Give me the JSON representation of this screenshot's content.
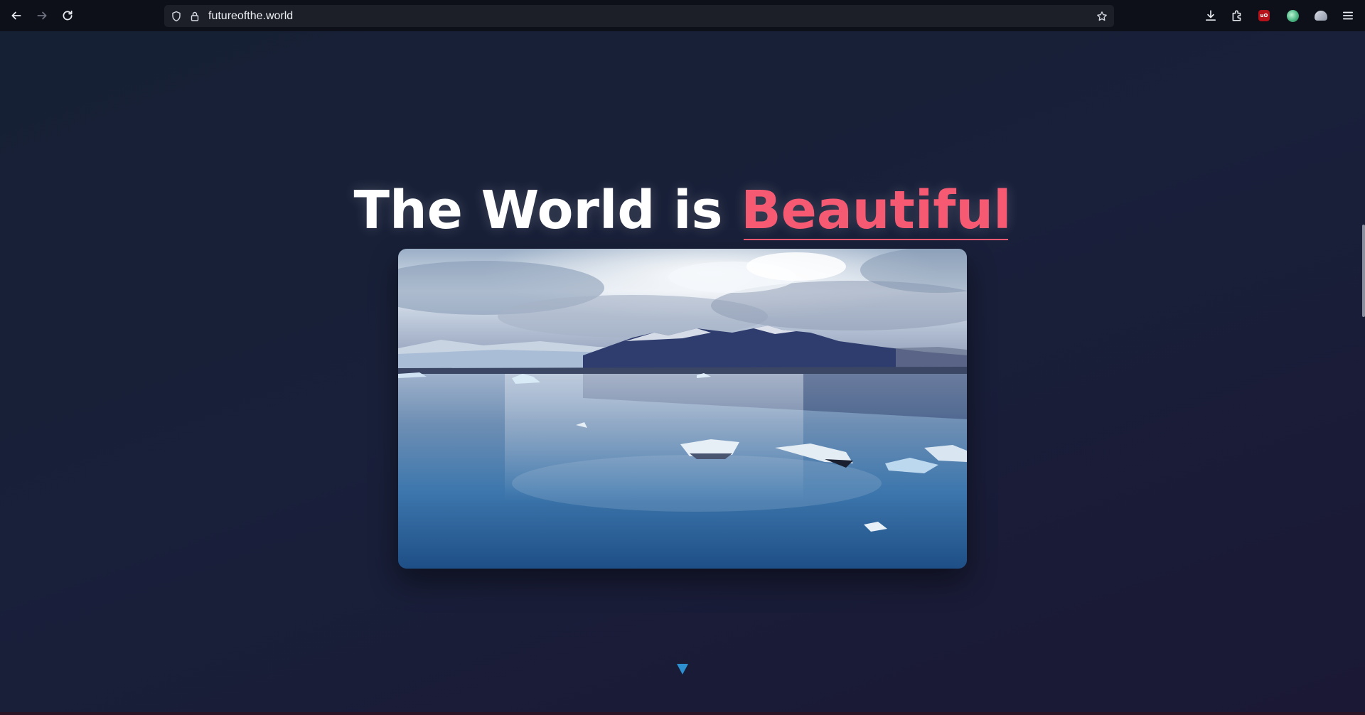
{
  "browser": {
    "url": "futureofthe.world",
    "icons": {
      "back": "back-arrow-icon",
      "forward": "forward-arrow-icon",
      "reload": "reload-icon",
      "shield": "shield-icon",
      "lock": "lock-icon",
      "bookmark": "star-icon",
      "downloads": "download-icon",
      "extensions": "puzzle-icon",
      "ublock": "ublock-origin-icon",
      "ext_green": "green-globe-extension-icon",
      "ext_cloud": "cloud-extension-icon",
      "menu": "hamburger-menu-icon"
    },
    "ext_red_label": "uO"
  },
  "hero": {
    "title_plain": "The World is ",
    "title_accent": "Beautiful"
  },
  "media": {
    "alt": "Glacier lagoon with floating icebergs and mountains",
    "icons": {
      "scroll_down": "down-triangle-icon"
    }
  },
  "colors": {
    "background": "#18203a",
    "accent": "#f55a72",
    "headline": "#ffffff",
    "scroll_arrow": "#2d8fd0",
    "toolbar": "#0d1018",
    "urlbar": "#1c1f28"
  }
}
